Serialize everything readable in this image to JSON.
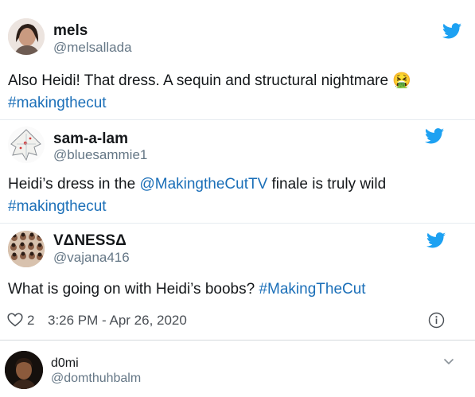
{
  "tweets": [
    {
      "name": "mels",
      "handle": "@melsallada",
      "text": "Also Heidi! That dress. A sequin and structural nightmare ",
      "emoji": "🤮",
      "hashtag": "#makingthecut"
    },
    {
      "name": "sam-a-lam",
      "handle": "@bluesammie1",
      "text_before": "Heidi’s dress in the ",
      "mention": "@MakingtheCutTV",
      "text_after": " finale is truly wild",
      "hashtag": "#makingthecut"
    },
    {
      "name": "VΔNESSΔ",
      "handle": "@vajana416",
      "text": "What is going on with Heidi’s boobs? ",
      "hashtag": "#MakingTheCut",
      "likes": "2",
      "timestamp": "3:26 PM - Apr 26, 2020"
    }
  ],
  "reply": {
    "name": "d0mi",
    "handle": "@domthuhbalm"
  },
  "colors": {
    "link": "#1b6fb8",
    "twitter_blue": "#1da1f2",
    "handle_gray": "#657786"
  },
  "icons": [
    "twitter-bird-icon",
    "heart-icon",
    "info-icon",
    "chevron-down-icon"
  ]
}
